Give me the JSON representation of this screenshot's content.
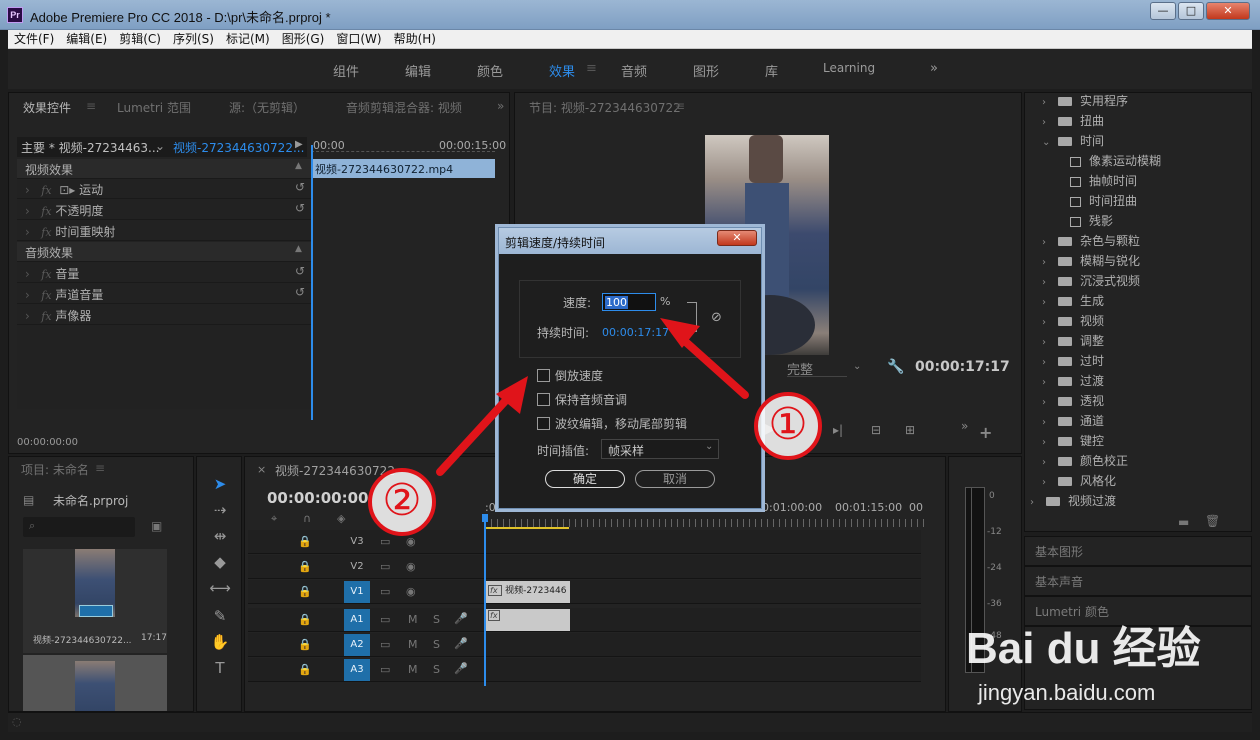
{
  "window": {
    "title": "Adobe Premiere Pro CC 2018 - D:\\pr\\未命名.prproj *",
    "logo": "Pr",
    "controls": [
      "—",
      "□",
      "✕"
    ]
  },
  "menu": [
    "文件(F)",
    "编辑(E)",
    "剪辑(C)",
    "序列(S)",
    "标记(M)",
    "图形(G)",
    "窗口(W)",
    "帮助(H)"
  ],
  "workspaces": [
    "组件",
    "编辑",
    "颜色",
    "效果",
    "音频",
    "图形",
    "库",
    "Learning"
  ],
  "workspace_active": "效果",
  "workspace_more": "»",
  "source_panel": {
    "tabs": [
      "效果控件",
      "Lumetri 范围",
      "源:（无剪辑）",
      "音频剪辑混合器: 视频"
    ],
    "master_label": "主要 * 视频-27234463...",
    "clip_label": "视频-272344630722...",
    "time_start": "00:00",
    "time_end": "00:00:15:00",
    "clip_name": "视频-272344630722.mp4",
    "video_header": "视频效果",
    "audio_header": "音频效果",
    "video_effects": [
      "运动",
      "不透明度",
      "时间重映射"
    ],
    "audio_effects": [
      "音量",
      "声道音量",
      "声像器"
    ],
    "timecode": "00:00:00:00"
  },
  "program_panel": {
    "title": "节目: 视频-272344630722",
    "fit": "完整",
    "timecode": "00:00:17:17"
  },
  "effects_tree": {
    "items": [
      {
        "label": "实用程序",
        "type": "folder",
        "level": 1
      },
      {
        "label": "扭曲",
        "type": "folder",
        "level": 1
      },
      {
        "label": "时间",
        "type": "folder",
        "level": 1,
        "open": true
      },
      {
        "label": "像素运动模糊",
        "type": "effect",
        "level": 2
      },
      {
        "label": "抽帧时间",
        "type": "effect",
        "level": 2
      },
      {
        "label": "时间扭曲",
        "type": "effect",
        "level": 2
      },
      {
        "label": "残影",
        "type": "effect",
        "level": 2
      },
      {
        "label": "杂色与颗粒",
        "type": "folder",
        "level": 1
      },
      {
        "label": "模糊与锐化",
        "type": "folder",
        "level": 1
      },
      {
        "label": "沉浸式视频",
        "type": "folder",
        "level": 1
      },
      {
        "label": "生成",
        "type": "folder",
        "level": 1
      },
      {
        "label": "视频",
        "type": "folder",
        "level": 1
      },
      {
        "label": "调整",
        "type": "folder",
        "level": 1
      },
      {
        "label": "过时",
        "type": "folder",
        "level": 1
      },
      {
        "label": "过渡",
        "type": "folder",
        "level": 1
      },
      {
        "label": "透视",
        "type": "folder",
        "level": 1
      },
      {
        "label": "通道",
        "type": "folder",
        "level": 1
      },
      {
        "label": "键控",
        "type": "folder",
        "level": 1
      },
      {
        "label": "颜色校正",
        "type": "folder",
        "level": 1
      },
      {
        "label": "风格化",
        "type": "folder",
        "level": 1
      },
      {
        "label": "视频过渡",
        "type": "folder",
        "level": 0
      }
    ],
    "collapsed_panels": [
      "基本图形",
      "基本声音",
      "Lumetri 颜色"
    ]
  },
  "project_panel": {
    "title": "项目: 未命名",
    "file": "未命名.prproj",
    "clip_name": "视频-272344630722...",
    "clip_duration": "17:17"
  },
  "timeline": {
    "tab": "视频-272344630722",
    "timecode": "00:00:00:00",
    "ruler": [
      ":00:00",
      "00:01:00:00",
      "00:01:15:00",
      "00"
    ],
    "tracks": [
      "V3",
      "V2",
      "V1",
      "A1",
      "A2",
      "A3"
    ],
    "track_buttons": [
      "M",
      "S"
    ],
    "clip_label": "视频-2723446"
  },
  "meter": {
    "labels": [
      "0",
      "-12",
      "-24",
      "-36",
      "-48"
    ]
  },
  "dialog": {
    "title": "剪辑速度/持续时间",
    "close": "✕",
    "speed_label": "速度:",
    "speed_value": "100",
    "speed_unit": "%",
    "duration_label": "持续时间:",
    "duration_value": "00:00:17:17",
    "reverse_label": "倒放速度",
    "keep_pitch_label": "保持音频音调",
    "ripple_label": "波纹编辑，移动尾部剪辑",
    "interp_label": "时间插值:",
    "interp_value": "帧采样",
    "ok": "确定",
    "cancel": "取消"
  },
  "annotations": {
    "one": "①",
    "two": "②"
  },
  "watermark": {
    "brand": "Bai du 经验",
    "url": "jingyan.baidu.com"
  },
  "colors": {
    "accent": "#2d8ceb",
    "annotation": "#e0141a",
    "track_on": "#1f6fa9"
  }
}
